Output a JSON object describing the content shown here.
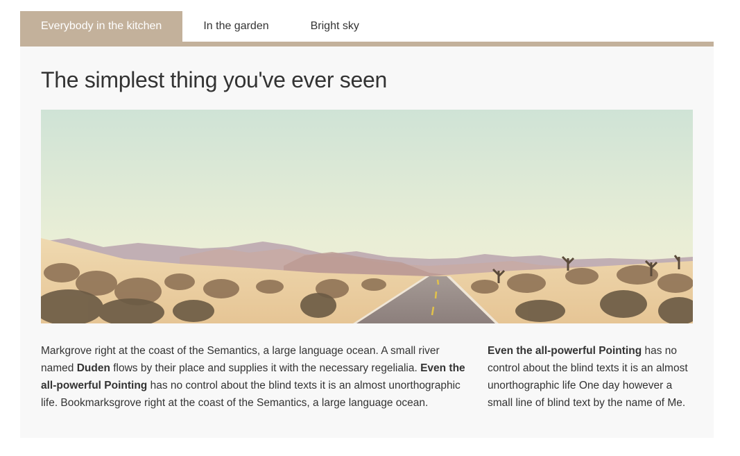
{
  "tabs": [
    {
      "label": "Everybody in the kitchen",
      "active": true
    },
    {
      "label": "In the garden",
      "active": false
    },
    {
      "label": "Bright sky",
      "active": false
    }
  ],
  "content": {
    "title": "The simplest thing you've ever seen",
    "left": {
      "t1": "Markgrove right at the coast of the Semantics, a large language ocean. A small river named ",
      "b1": "Duden",
      "t2": " flows by their place and supplies it with the necessary regelialia. ",
      "b2": "Even the all-powerful Pointing",
      "t3": " has no control about the blind texts it is an almost unorthographic life. Bookmarksgrove right at the coast of the Semantics, a large language ocean."
    },
    "right": {
      "b1": "Even the all-powerful Pointing",
      "t1": " has no control about the blind texts it is an almost unorthographic life One day however a small line of blind text by the name of Me."
    }
  },
  "colors": {
    "accent": "#c3b19b",
    "panel": "#f8f8f8",
    "text": "#333333"
  }
}
